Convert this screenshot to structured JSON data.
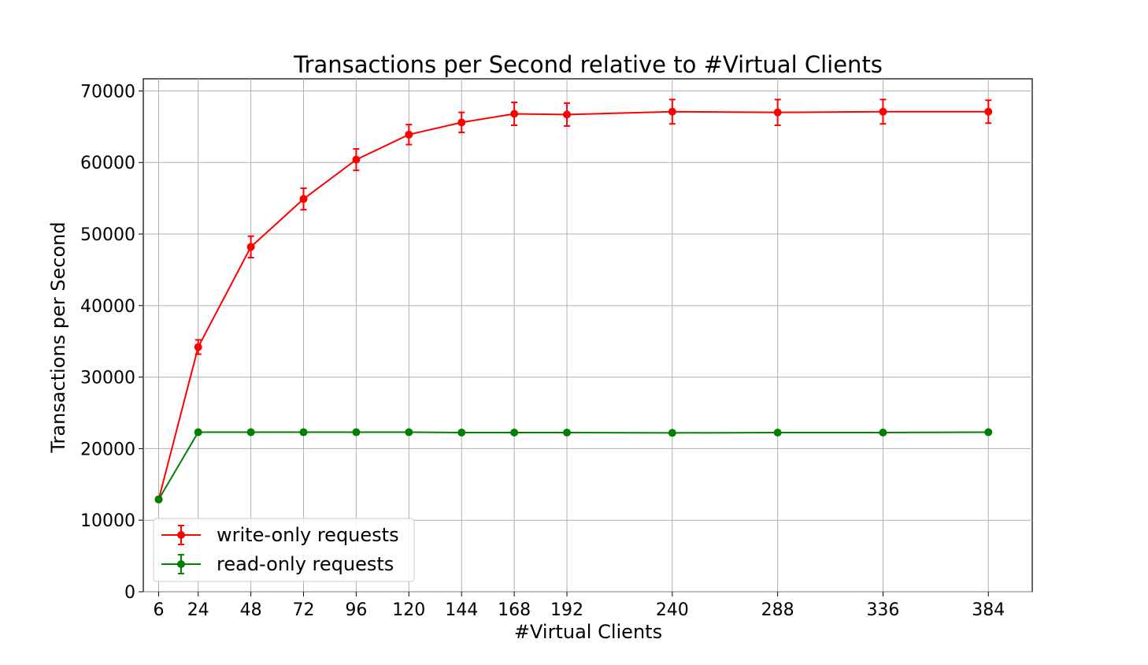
{
  "chart_data": {
    "type": "line",
    "title": "Transactions per Second relative to #Virtual Clients",
    "xlabel": "#Virtual Clients",
    "ylabel": "Transactions per Second",
    "x": [
      6,
      24,
      48,
      72,
      96,
      120,
      144,
      168,
      192,
      240,
      288,
      336,
      384
    ],
    "xticks": [
      6,
      24,
      48,
      72,
      96,
      120,
      144,
      168,
      192,
      240,
      288,
      336,
      384
    ],
    "yticks": [
      0,
      10000,
      20000,
      30000,
      40000,
      50000,
      60000,
      70000
    ],
    "xlim": [
      -1,
      404
    ],
    "ylim": [
      0,
      71700
    ],
    "grid": true,
    "legend_position": "lower-left",
    "series": [
      {
        "name": "write-only requests",
        "color": "#ff0000",
        "values": [
          12900,
          34200,
          48200,
          54900,
          60400,
          63900,
          65600,
          66800,
          66700,
          67100,
          67000,
          67100,
          67100
        ],
        "errors": [
          300,
          1000,
          1500,
          1500,
          1500,
          1400,
          1400,
          1600,
          1600,
          1700,
          1800,
          1700,
          1600
        ]
      },
      {
        "name": "read-only requests",
        "color": "#008000",
        "values": [
          12900,
          22300,
          22300,
          22300,
          22300,
          22300,
          22250,
          22250,
          22250,
          22200,
          22250,
          22250,
          22300
        ],
        "errors": [
          300,
          200,
          150,
          150,
          150,
          150,
          150,
          150,
          150,
          150,
          150,
          150,
          150
        ]
      }
    ]
  }
}
